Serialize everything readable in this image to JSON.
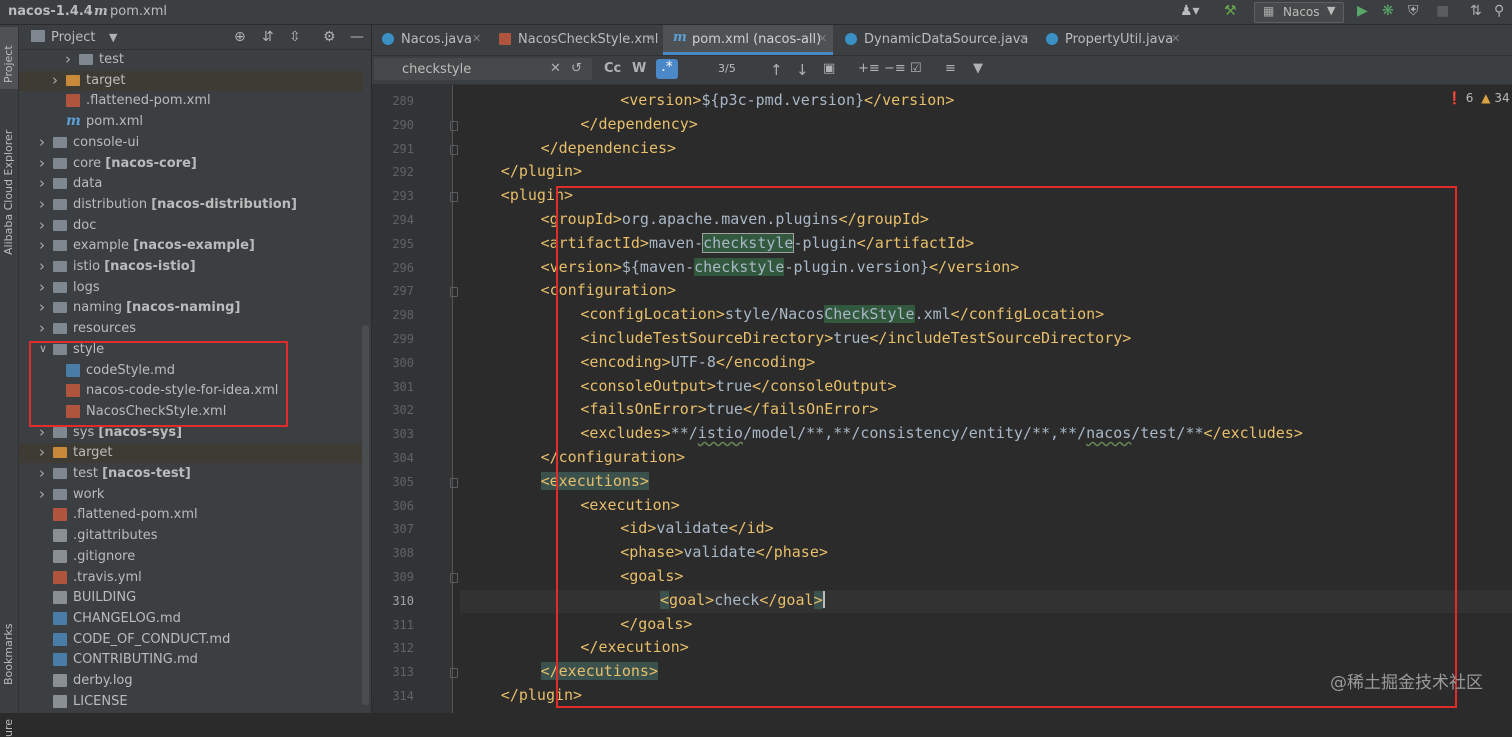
{
  "navbar": {
    "project": "nacos-1.4.4",
    "file": "pom.xml",
    "run_config": "Nacos"
  },
  "left_stripe": {
    "project_label": "Project",
    "cloud_label": "Alibaba Cloud Explorer",
    "bookmarks_label": "Bookmarks",
    "structure_label": "ure"
  },
  "project_panel": {
    "title": "Project",
    "tree": [
      {
        "label": "test",
        "module": "",
        "type": "folder",
        "indent": 4,
        "arrow": "right",
        "excluded": false
      },
      {
        "label": "target",
        "module": "",
        "type": "folder-orange",
        "indent": 3,
        "arrow": "right",
        "excluded": true
      },
      {
        "label": ".flattened-pom.xml",
        "module": "",
        "type": "xml",
        "indent": 3,
        "arrow": "",
        "excluded": false
      },
      {
        "label": "pom.xml",
        "module": "",
        "type": "m",
        "indent": 3,
        "arrow": "",
        "excluded": false
      },
      {
        "label": "console-ui",
        "module": "",
        "type": "folder",
        "indent": 2,
        "arrow": "right",
        "excluded": false
      },
      {
        "label": "core ",
        "module": "[nacos-core]",
        "type": "folder",
        "indent": 2,
        "arrow": "right",
        "excluded": false
      },
      {
        "label": "data",
        "module": "",
        "type": "folder",
        "indent": 2,
        "arrow": "right",
        "excluded": false
      },
      {
        "label": "distribution ",
        "module": "[nacos-distribution]",
        "type": "folder",
        "indent": 2,
        "arrow": "right",
        "excluded": false
      },
      {
        "label": "doc",
        "module": "",
        "type": "folder",
        "indent": 2,
        "arrow": "right",
        "excluded": false
      },
      {
        "label": "example ",
        "module": "[nacos-example]",
        "type": "folder",
        "indent": 2,
        "arrow": "right",
        "excluded": false
      },
      {
        "label": "istio ",
        "module": "[nacos-istio]",
        "type": "folder",
        "indent": 2,
        "arrow": "right",
        "excluded": false
      },
      {
        "label": "logs",
        "module": "",
        "type": "folder",
        "indent": 2,
        "arrow": "right",
        "excluded": false
      },
      {
        "label": "naming ",
        "module": "[nacos-naming]",
        "type": "folder",
        "indent": 2,
        "arrow": "right",
        "excluded": false
      },
      {
        "label": "resources",
        "module": "",
        "type": "folder",
        "indent": 2,
        "arrow": "right",
        "excluded": false
      },
      {
        "label": "style",
        "module": "",
        "type": "folder",
        "indent": 2,
        "arrow": "down",
        "excluded": false
      },
      {
        "label": "codeStyle.md",
        "module": "",
        "type": "md",
        "indent": 3,
        "arrow": "",
        "excluded": false
      },
      {
        "label": "nacos-code-style-for-idea.xml",
        "module": "",
        "type": "xml",
        "indent": 3,
        "arrow": "",
        "excluded": false
      },
      {
        "label": "NacosCheckStyle.xml",
        "module": "",
        "type": "xml",
        "indent": 3,
        "arrow": "",
        "excluded": false
      },
      {
        "label": "sys ",
        "module": "[nacos-sys]",
        "type": "folder",
        "indent": 2,
        "arrow": "right",
        "excluded": false
      },
      {
        "label": "target",
        "module": "",
        "type": "folder-orange",
        "indent": 2,
        "arrow": "right",
        "excluded": true
      },
      {
        "label": "test ",
        "module": "[nacos-test]",
        "type": "folder",
        "indent": 2,
        "arrow": "right",
        "excluded": false
      },
      {
        "label": "work",
        "module": "",
        "type": "folder",
        "indent": 2,
        "arrow": "right",
        "excluded": false
      },
      {
        "label": ".flattened-pom.xml",
        "module": "",
        "type": "xml",
        "indent": 2,
        "arrow": "",
        "excluded": false
      },
      {
        "label": ".gitattributes",
        "module": "",
        "type": "gen",
        "indent": 2,
        "arrow": "",
        "excluded": false
      },
      {
        "label": ".gitignore",
        "module": "",
        "type": "gen",
        "indent": 2,
        "arrow": "",
        "excluded": false
      },
      {
        "label": ".travis.yml",
        "module": "",
        "type": "xml",
        "indent": 2,
        "arrow": "",
        "excluded": false
      },
      {
        "label": "BUILDING",
        "module": "",
        "type": "gen",
        "indent": 2,
        "arrow": "",
        "excluded": false
      },
      {
        "label": "CHANGELOG.md",
        "module": "",
        "type": "md",
        "indent": 2,
        "arrow": "",
        "excluded": false
      },
      {
        "label": "CODE_OF_CONDUCT.md",
        "module": "",
        "type": "md",
        "indent": 2,
        "arrow": "",
        "excluded": false
      },
      {
        "label": "CONTRIBUTING.md",
        "module": "",
        "type": "md",
        "indent": 2,
        "arrow": "",
        "excluded": false
      },
      {
        "label": "derby.log",
        "module": "",
        "type": "gen",
        "indent": 2,
        "arrow": "",
        "excluded": false
      },
      {
        "label": "LICENSE",
        "module": "",
        "type": "gen",
        "indent": 2,
        "arrow": "",
        "excluded": false
      }
    ]
  },
  "tabs": [
    {
      "label": "Nacos.java",
      "active": false,
      "icon": "c"
    },
    {
      "label": "NacosCheckStyle.xml",
      "active": false,
      "icon": "xml"
    },
    {
      "label": "pom.xml (nacos-all)",
      "active": true,
      "icon": "m"
    },
    {
      "label": "DynamicDataSource.java",
      "active": false,
      "icon": "c"
    },
    {
      "label": "PropertyUtil.java",
      "active": false,
      "icon": "c"
    }
  ],
  "search": {
    "query": "checkstyle",
    "match_count": "3/5",
    "case_label": "Cc",
    "regex_label": ".*"
  },
  "problems": {
    "errors": "6",
    "warnings": "34"
  },
  "editor": {
    "lines": [
      {
        "n": "289",
        "indent": 16,
        "html": "<span class='tg'>&lt;version&gt;</span>${p3c-pmd.version}<span class='tg'>&lt;/version&gt;</span>"
      },
      {
        "n": "290",
        "indent": 12,
        "html": "<span class='tg'>&lt;/dependency&gt;</span>"
      },
      {
        "n": "291",
        "indent": 8,
        "html": "<span class='tg'>&lt;/dependencies&gt;</span>"
      },
      {
        "n": "292",
        "indent": 4,
        "html": "<span class='tg'>&lt;/plugin&gt;</span>"
      },
      {
        "n": "293",
        "indent": 4,
        "html": "<span class='tg'>&lt;plugin&gt;</span>"
      },
      {
        "n": "294",
        "indent": 8,
        "html": "<span class='tg'>&lt;groupId&gt;</span>org.apache.maven.plugins<span class='tg'>&lt;/groupId&gt;</span>"
      },
      {
        "n": "295",
        "indent": 8,
        "html": "<span class='tg'>&lt;artifactId&gt;</span>maven-<span class='hl-box'>checkstyle</span>-plugin<span class='tg'>&lt;/artifactId&gt;</span>"
      },
      {
        "n": "296",
        "indent": 8,
        "html": "<span class='tg'>&lt;version&gt;</span>${maven-<span class='hl'>checkstyle</span>-plugin.version}<span class='tg'>&lt;/version&gt;</span>"
      },
      {
        "n": "297",
        "indent": 8,
        "html": "<span class='tg'>&lt;configuration&gt;</span>"
      },
      {
        "n": "298",
        "indent": 12,
        "html": "<span class='tg'>&lt;configLocation&gt;</span>style/Nacos<span class='hl'>CheckStyle</span>.xml<span class='tg'>&lt;/configLocation&gt;</span>"
      },
      {
        "n": "299",
        "indent": 12,
        "html": "<span class='tg'>&lt;includeTestSourceDirectory&gt;</span>true<span class='tg'>&lt;/includeTestSourceDirectory&gt;</span>"
      },
      {
        "n": "300",
        "indent": 12,
        "html": "<span class='tg'>&lt;encoding&gt;</span>UTF-8<span class='tg'>&lt;/encoding&gt;</span>"
      },
      {
        "n": "301",
        "indent": 12,
        "html": "<span class='tg'>&lt;consoleOutput&gt;</span>true<span class='tg'>&lt;/consoleOutput&gt;</span>"
      },
      {
        "n": "302",
        "indent": 12,
        "html": "<span class='tg'>&lt;failsOnError&gt;</span>true<span class='tg'>&lt;/failsOnError&gt;</span>"
      },
      {
        "n": "303",
        "indent": 12,
        "html": "<span class='tg'>&lt;excludes&gt;</span>**/<span class='squig'>istio</span>/model/**,**/consistency/entity/**,**/<span class='squig'>nacos</span>/test/**<span class='tg'>&lt;/excludes&gt;</span>"
      },
      {
        "n": "304",
        "indent": 8,
        "html": "<span class='tg'>&lt;/configuration&gt;</span>"
      },
      {
        "n": "305",
        "indent": 8,
        "html": "<span class='tg hl-tag'>&lt;executions&gt;</span>"
      },
      {
        "n": "306",
        "indent": 12,
        "html": "<span class='tg'>&lt;execution&gt;</span>"
      },
      {
        "n": "307",
        "indent": 16,
        "html": "<span class='tg'>&lt;id&gt;</span>validate<span class='tg'>&lt;/id&gt;</span>"
      },
      {
        "n": "308",
        "indent": 16,
        "html": "<span class='tg'>&lt;phase&gt;</span>validate<span class='tg'>&lt;/phase&gt;</span>"
      },
      {
        "n": "309",
        "indent": 16,
        "html": "<span class='tg'>&lt;goals&gt;</span>"
      },
      {
        "n": "310",
        "indent": 20,
        "html": "<span class='tg'><span class='hl-tag'>&lt;</span>goal&gt;</span>check<span class='tg'>&lt;/goal<span class='hl-tag'>&gt;</span></span><span class='caret'></span>"
      },
      {
        "n": "311",
        "indent": 16,
        "html": "<span class='tg'>&lt;/goals&gt;</span>"
      },
      {
        "n": "312",
        "indent": 12,
        "html": "<span class='tg'>&lt;/execution&gt;</span>"
      },
      {
        "n": "313",
        "indent": 8,
        "html": "<span class='tg hl-tag'>&lt;/executions&gt;</span>"
      },
      {
        "n": "314",
        "indent": 4,
        "html": "<span class='tg'>&lt;/plugin&gt;</span>"
      }
    ]
  },
  "watermark": "@稀土掘金技术社区"
}
